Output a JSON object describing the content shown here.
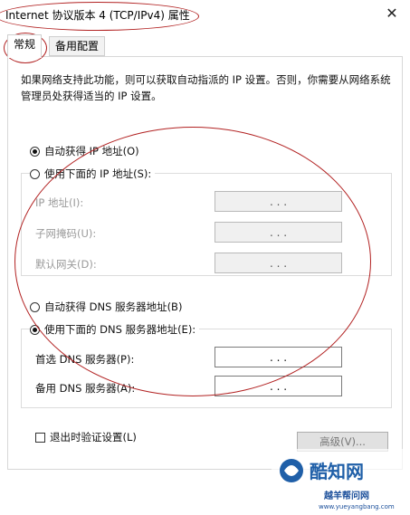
{
  "window": {
    "title": "Internet 协议版本 4 (TCP/IPv4) 属性",
    "close_glyph": "✕"
  },
  "tabs": [
    {
      "label": "常规",
      "active": true
    },
    {
      "label": "备用配置",
      "active": false
    }
  ],
  "description": "如果网络支持此功能，则可以获取自动指派的 IP 设置。否则，你需要从网络系统管理员处获得适当的 IP 设置。",
  "ip_section": {
    "auto_ip": {
      "label": "自动获得 IP 地址(O)",
      "checked": true
    },
    "manual_ip": {
      "label": "使用下面的 IP 地址(S):",
      "checked": false
    },
    "fields": [
      {
        "label": "IP 地址(I):",
        "value": ". . ."
      },
      {
        "label": "子网掩码(U):",
        "value": ". . ."
      },
      {
        "label": "默认网关(D):",
        "value": ". . ."
      }
    ]
  },
  "dns_section": {
    "auto_dns": {
      "label": "自动获得 DNS 服务器地址(B)",
      "checked": false
    },
    "manual_dns": {
      "label": "使用下面的 DNS 服务器地址(E):",
      "checked": true
    },
    "fields": [
      {
        "label": "首选 DNS 服务器(P):",
        "value": ". . ."
      },
      {
        "label": "备用 DNS 服务器(A):",
        "value": ". . ."
      }
    ]
  },
  "footer": {
    "validate_on_exit": {
      "label": "退出时验证设置(L)",
      "checked": false
    },
    "advanced_button": "高级(V)..."
  },
  "watermark": {
    "brand": "酷知网",
    "site_name": "越羊帮问网",
    "site_url": "www.yueyangbang.com"
  },
  "annotation_color": "#b22222"
}
